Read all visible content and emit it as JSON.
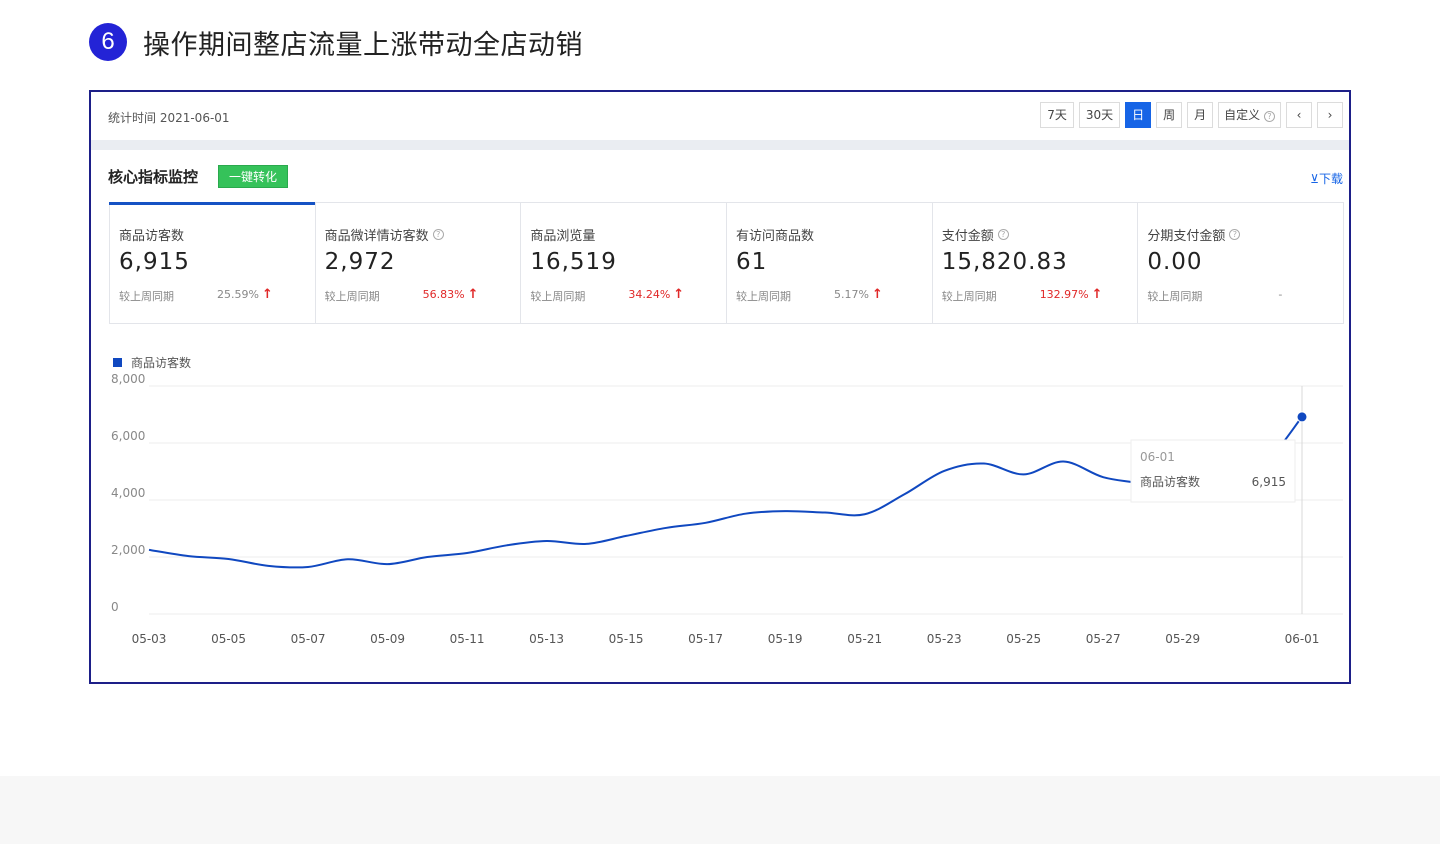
{
  "heading": {
    "step": "6",
    "title": "操作期间整店流量上涨带动全店动销"
  },
  "topbar": {
    "stat_time": "统计时间 2021-06-01",
    "ranges": [
      "7天",
      "30天",
      "日",
      "周",
      "月"
    ],
    "active_range": "日",
    "custom": "自定义",
    "prev": "‹",
    "next": "›"
  },
  "section": {
    "title": "核心指标监控",
    "convert_button": "一键转化",
    "download": "⊻下载"
  },
  "cards": [
    {
      "label": "商品访客数",
      "help": false,
      "value": "6,915",
      "compare": "较上周同期",
      "change": "25.59%",
      "trend": "up",
      "color": "#888888"
    },
    {
      "label": "商品微详情访客数",
      "help": true,
      "value": "2,972",
      "compare": "较上周同期",
      "change": "56.83%",
      "trend": "up",
      "color": "#e02828"
    },
    {
      "label": "商品浏览量",
      "help": false,
      "value": "16,519",
      "compare": "较上周同期",
      "change": "34.24%",
      "trend": "up",
      "color": "#e02828"
    },
    {
      "label": "有访问商品数",
      "help": false,
      "value": "61",
      "compare": "较上周同期",
      "change": "5.17%",
      "trend": "up",
      "color": "#888888"
    },
    {
      "label": "支付金额",
      "help": true,
      "value": "15,820.83",
      "compare": "较上周同期",
      "change": "132.97%",
      "trend": "up",
      "color": "#e02828"
    },
    {
      "label": "分期支付金额",
      "help": true,
      "value": "0.00",
      "compare": "较上周同期",
      "change": "-",
      "trend": "none",
      "color": "#888888"
    }
  ],
  "chart_data": {
    "type": "line",
    "legend": "商品访客数",
    "legend_position": "top-left",
    "series_color": "#1048c0",
    "ylim": [
      0,
      8000
    ],
    "yticks": [
      0,
      2000,
      4000,
      6000,
      8000
    ],
    "ytick_labels": [
      "0",
      "2,000",
      "4,000",
      "6,000",
      "8,000"
    ],
    "xtick_labels": [
      "05-03",
      "05-05",
      "05-07",
      "05-09",
      "05-11",
      "05-13",
      "05-15",
      "05-17",
      "05-19",
      "05-21",
      "05-23",
      "05-25",
      "05-27",
      "05-29",
      "06-01"
    ],
    "x": [
      "05-03",
      "05-04",
      "05-05",
      "05-06",
      "05-07",
      "05-08",
      "05-09",
      "05-10",
      "05-11",
      "05-12",
      "05-13",
      "05-14",
      "05-15",
      "05-16",
      "05-17",
      "05-18",
      "05-19",
      "05-20",
      "05-21",
      "05-22",
      "05-23",
      "05-24",
      "05-25",
      "05-26",
      "05-27",
      "05-28",
      "05-29",
      "05-30",
      "05-31",
      "06-01"
    ],
    "values": [
      2250,
      2030,
      1930,
      1690,
      1650,
      1920,
      1750,
      2000,
      2140,
      2410,
      2560,
      2460,
      2740,
      3020,
      3200,
      3520,
      3610,
      3560,
      3500,
      4200,
      5020,
      5280,
      4900,
      5350,
      4800,
      4560,
      4150,
      4380,
      5150,
      6915
    ],
    "grid": true,
    "tooltip": {
      "date": "06-01",
      "label": "商品访客数",
      "value": "6,915"
    }
  }
}
